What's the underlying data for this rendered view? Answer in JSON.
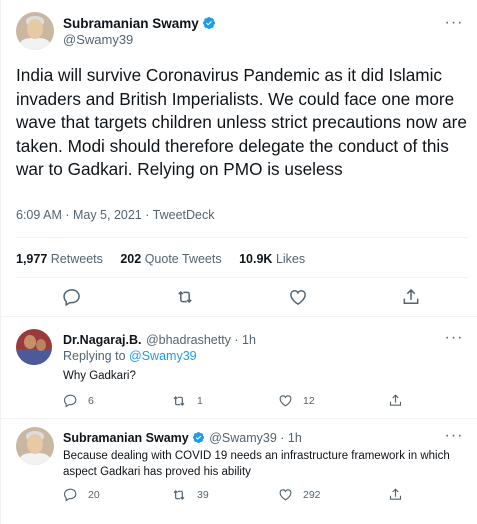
{
  "main_tweet": {
    "author_name": "Subramanian Swamy",
    "author_handle": "@Swamy39",
    "text": "India will survive Coronavirus Pandemic as it did Islamic invaders and British Imperialists. We could face one more wave that targets children unless strict precautions now are taken. Modi should therefore delegate the conduct of  this war to Gadkari. Relying on PMO is useless",
    "timestamp": "6:09 AM · May 5, 2021 · TweetDeck",
    "retweets_count": "1,977",
    "retweets_label": "Retweets",
    "quote_count": "202",
    "quote_label": "Quote Tweets",
    "likes_count": "10.9K",
    "likes_label": "Likes"
  },
  "replies": [
    {
      "author_name": "Dr.Nagaraj.B.",
      "author_handle": "@bhadrashetty · 1h",
      "replying_prefix": "Replying to",
      "replying_to": "@Swamy39",
      "text": "Why Gadkari?",
      "reply_count": "6",
      "retweet_count": "1",
      "like_count": "12"
    },
    {
      "author_name": "Subramanian Swamy",
      "author_handle": "@Swamy39 · 1h",
      "text": "Because dealing with COVID 19 needs an infrastructure framework in which aspect Gadkari has proved his ability",
      "reply_count": "20",
      "retweet_count": "39",
      "like_count": "292"
    }
  ],
  "colors": {
    "accent": "#1d9bf0",
    "text_primary": "#0f1419",
    "text_secondary": "#536471",
    "divider": "#eff3f4"
  },
  "icons": [
    "verified-badge-icon",
    "more-icon",
    "reply-icon",
    "retweet-icon",
    "like-icon",
    "share-icon"
  ]
}
